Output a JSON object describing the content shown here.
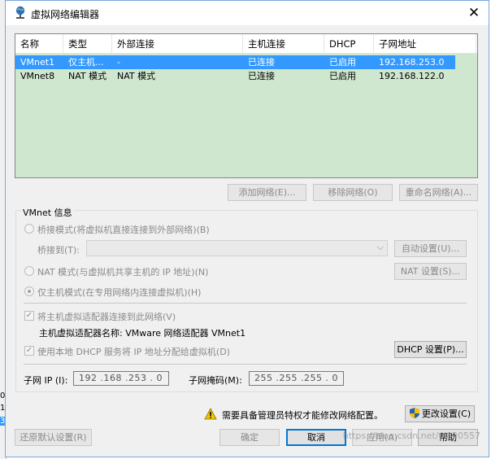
{
  "backdrop": {
    "marks": [
      "0",
      "1",
      "3"
    ]
  },
  "window": {
    "title": "虚拟网络编辑器",
    "close_glyph": "✕"
  },
  "table": {
    "columns": [
      "名称",
      "类型",
      "外部连接",
      "主机连接",
      "DHCP",
      "子网地址"
    ],
    "rows": [
      {
        "name": "VMnet1",
        "type": "仅主机...",
        "external": "-",
        "host": "已连接",
        "dhcp": "已启用",
        "subnet": "192.168.253.0",
        "selected": true
      },
      {
        "name": "VMnet8",
        "type": "NAT 模式",
        "external": "NAT 模式",
        "host": "已连接",
        "dhcp": "已启用",
        "subnet": "192.168.122.0",
        "selected": false
      }
    ],
    "row_color": "#cfe6cf",
    "selected_color": "#3399ff"
  },
  "table_buttons": {
    "add": "添加网络(E)...",
    "remove": "移除网络(O)",
    "rename": "重命名网络(A)..."
  },
  "vmnet_info": {
    "label": "VMnet 信息",
    "bridged": "桥接模式(将虚拟机直接连接到外部网络)(B)",
    "bridged_to": "桥接到(T):",
    "auto_settings": "自动设置(U)...",
    "nat": "NAT 模式(与虚拟机共享主机的 IP 地址)(N)",
    "nat_settings": "NAT 设置(S)...",
    "host_only": "仅主机模式(在专用网络内连接虚拟机)(H)",
    "connect_adapter": "将主机虚拟适配器连接到此网络(V)",
    "adapter_name": "主机虚拟适配器名称: VMware 网络适配器 VMnet1",
    "use_dhcp": "使用本地 DHCP 服务将 IP 地址分配给虚拟机(D)",
    "dhcp_settings": "DHCP 设置(P)...",
    "subnet_ip_label": "子网 IP (I):",
    "subnet_ip": "192 .168 .253 . 0",
    "subnet_mask_label": "子网掩码(M):",
    "subnet_mask": "255 .255 .255 . 0"
  },
  "admin_notice": "需要具备管理员特权才能修改网络配置。",
  "change_settings": "更改设置(C)",
  "footer": {
    "restore": "还原默认设置(R)",
    "ok": "确定",
    "cancel": "取消",
    "apply": "应用(A)",
    "help": "帮助"
  },
  "watermark": "https://blog.csdn.net/yl820557",
  "colors": {
    "accent": "#0078d7",
    "warning": "#f5c400"
  }
}
